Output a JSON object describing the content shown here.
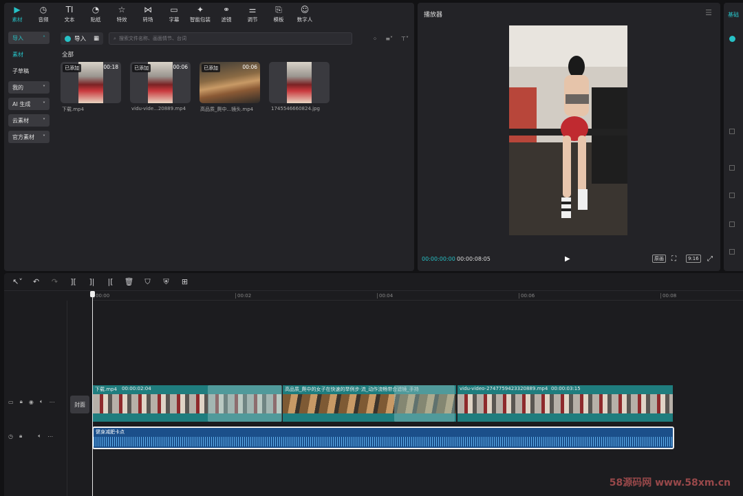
{
  "toolbar": {
    "items": [
      {
        "label": "素材",
        "icon": "media-icon"
      },
      {
        "label": "音频",
        "icon": "audio-icon"
      },
      {
        "label": "文本",
        "icon": "text-icon"
      },
      {
        "label": "贴纸",
        "icon": "sticker-icon"
      },
      {
        "label": "特效",
        "icon": "effects-icon"
      },
      {
        "label": "转场",
        "icon": "transition-icon"
      },
      {
        "label": "字幕",
        "icon": "subtitle-icon"
      },
      {
        "label": "智能包装",
        "icon": "smart-pack-icon"
      },
      {
        "label": "滤镜",
        "icon": "filter-icon"
      },
      {
        "label": "调节",
        "icon": "adjust-icon"
      },
      {
        "label": "模板",
        "icon": "template-icon"
      },
      {
        "label": "数字人",
        "icon": "avatar-icon"
      }
    ],
    "active": "素材"
  },
  "sidebar": {
    "import": "导入",
    "material": "素材",
    "subtitle_draft": "子草稿",
    "mine": "我的",
    "ai": "AI 生成",
    "cloud": "云素材",
    "official": "官方素材"
  },
  "library": {
    "import_button": "导入",
    "search_placeholder": "搜索文件名称、画面情节、台词",
    "all": "全部",
    "cards": [
      {
        "badge": "已添加",
        "duration": "00:18",
        "name": "下载.mp4"
      },
      {
        "badge": "已添加",
        "duration": "00:06",
        "name": "vidu-vide...20889.mp4"
      },
      {
        "badge": "已添加",
        "duration": "00:06",
        "name": "高品质_爬中...镜头.mp4"
      },
      {
        "badge": "",
        "duration": "",
        "name": "1745546660824.jpg"
      }
    ]
  },
  "player": {
    "title": "播放器",
    "current": "00:00:00:00",
    "total": "00:00:08:05",
    "quality": "原画",
    "ratio": "9:16"
  },
  "props": {
    "title": "基础"
  },
  "timeline": {
    "ruler": [
      "00:00",
      "00:02",
      "00:04",
      "00:06",
      "00:08"
    ],
    "cover": "封面",
    "clips": [
      {
        "name": "下载.mp4",
        "duration": "00:00:02:04"
      },
      {
        "name": "高品质_爬中的女子在快速的举例步·流_动作流畅带合滤镜_手持",
        "duration": ""
      },
      {
        "name": "vidu-video-2747759423320889.mp4",
        "duration": "00:00:03:15"
      }
    ],
    "audio": "健身减肥卡点"
  },
  "watermark": "58源码网 www.58xm.cn",
  "colors": {
    "accent": "#27c1c6",
    "video_track": "#1f7d7e",
    "audio_track": "#1b4f8a"
  }
}
